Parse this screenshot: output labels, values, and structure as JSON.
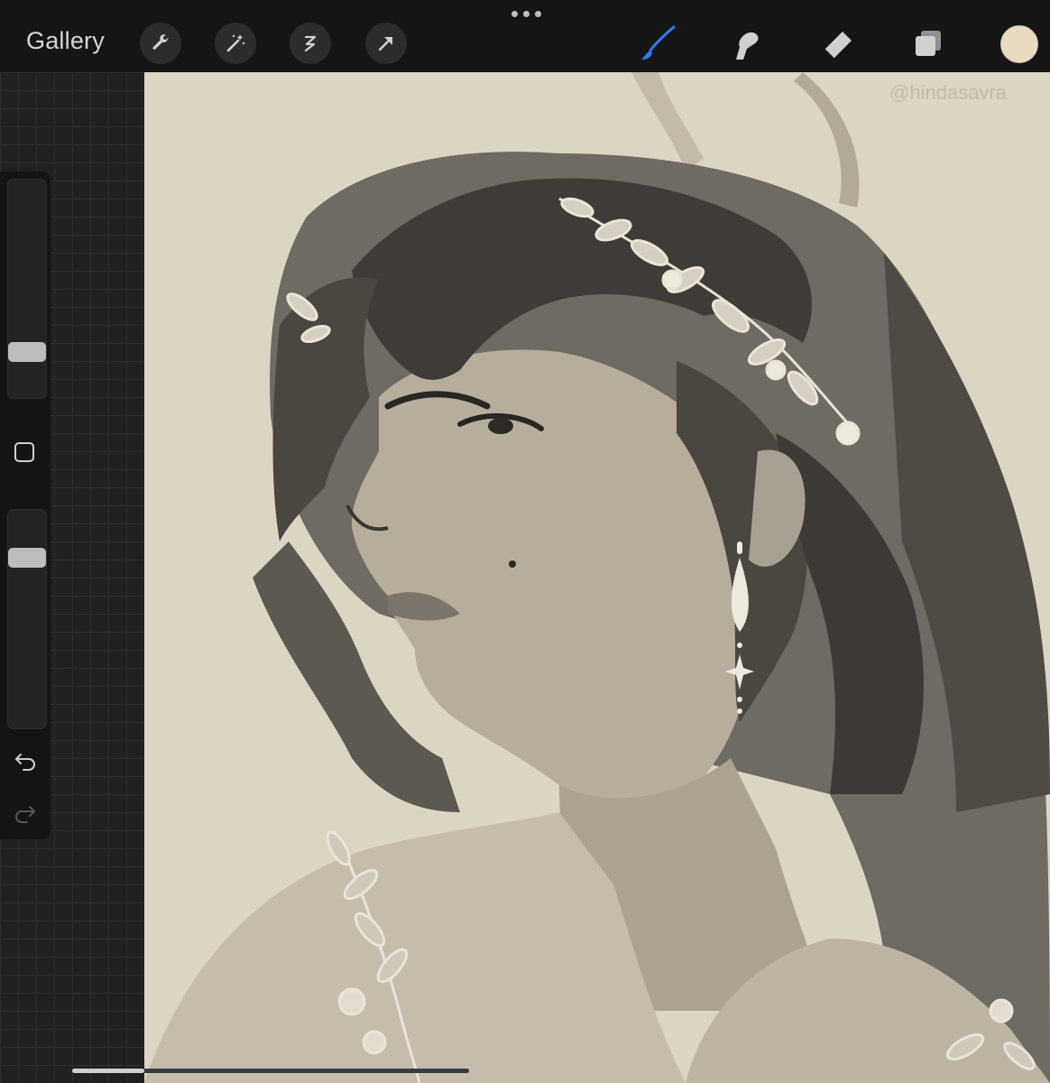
{
  "toolbar": {
    "gallery_label": "Gallery",
    "left_tools": [
      {
        "name": "actions",
        "icon": "wrench-icon"
      },
      {
        "name": "adjustments",
        "icon": "magic-wand-icon"
      },
      {
        "name": "selection",
        "icon": "selection-s-icon"
      },
      {
        "name": "transform",
        "icon": "arrow-cursor-icon"
      }
    ],
    "right_tools": [
      {
        "name": "brush",
        "icon": "brush-icon",
        "active": true
      },
      {
        "name": "smudge",
        "icon": "smudge-finger-icon"
      },
      {
        "name": "eraser",
        "icon": "eraser-icon"
      },
      {
        "name": "layers",
        "icon": "layers-icon"
      }
    ],
    "current_color": "#e9dbc2",
    "active_color": "#2f7cf6"
  },
  "sidebar": {
    "brush_size": 0.2,
    "opacity": 0.8,
    "buttons": [
      "modify-button",
      "undo-button",
      "redo-button"
    ]
  },
  "canvas": {
    "watermark": "@hindasavra",
    "background": "#ddd5c4"
  }
}
